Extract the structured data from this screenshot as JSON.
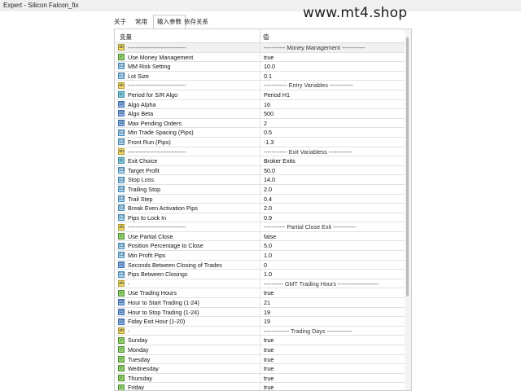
{
  "window": {
    "title": "Expert - Silicon Falcon_fix"
  },
  "watermark": "www.mt4.shop",
  "tabs": [
    {
      "label": "关于"
    },
    {
      "label": "常用"
    },
    {
      "label": "输入参数"
    },
    {
      "label": "依存关系"
    }
  ],
  "table": {
    "col_variable": "变量",
    "col_value": "值",
    "rows": [
      {
        "name": "------------------------------",
        "value": "----------- Money Management ------------",
        "icon": "variable-icon"
      },
      {
        "name": "Use Money Management",
        "value": "true",
        "icon": "boolean-icon"
      },
      {
        "name": "MM Risk Setting",
        "value": "10.0",
        "icon": "double-icon"
      },
      {
        "name": "Lot Size",
        "value": "0.1",
        "icon": "double-icon"
      },
      {
        "name": "------------------------------",
        "value": "------------ Entry Variables ------------",
        "icon": "variable-icon"
      },
      {
        "name": "Period for S/R Algo",
        "value": "Period H1",
        "icon": "enum-icon"
      },
      {
        "name": "Algo Alpha",
        "value": "16",
        "icon": "integer-icon"
      },
      {
        "name": "Algo Beta",
        "value": "500",
        "icon": "integer-icon"
      },
      {
        "name": "Max Pending Orders",
        "value": "2",
        "icon": "integer-icon"
      },
      {
        "name": "Min Trade Spacing (Pips)",
        "value": "0.5",
        "icon": "double-icon"
      },
      {
        "name": "Front Run (Pips)",
        "value": "-1.3",
        "icon": "double-icon"
      },
      {
        "name": "------------------------------",
        "value": "------------ Exit Variabless ------------",
        "icon": "variable-icon"
      },
      {
        "name": "Exit Choice",
        "value": "Broker Exits",
        "icon": "enum-icon"
      },
      {
        "name": "Target Profit",
        "value": "50.0",
        "icon": "double-icon"
      },
      {
        "name": "Stop Loss",
        "value": "14.0",
        "icon": "double-icon"
      },
      {
        "name": "Trailing Stop",
        "value": "2.0",
        "icon": "double-icon"
      },
      {
        "name": "Trail Step",
        "value": "0.4",
        "icon": "double-icon"
      },
      {
        "name": "Break Even Activation Pips",
        "value": "2.0",
        "icon": "double-icon"
      },
      {
        "name": "Pips to Lock In",
        "value": "0.9",
        "icon": "double-icon"
      },
      {
        "name": "------------------------------",
        "value": "----------- Partial Close Exit ------------",
        "icon": "variable-icon"
      },
      {
        "name": "Use Partial Close",
        "value": "false",
        "icon": "boolean-icon"
      },
      {
        "name": "Position Percentage to Close",
        "value": "5.0",
        "icon": "double-icon"
      },
      {
        "name": "Min Profit Pips",
        "value": "1.0",
        "icon": "double-icon"
      },
      {
        "name": "Seconds Between Closing of Trades",
        "value": "0",
        "icon": "integer-icon"
      },
      {
        "name": "Pips Between Closings",
        "value": "1.0",
        "icon": "double-icon"
      },
      {
        "name": "-",
        "value": "---------- GMT Trading Hours ---------------------",
        "icon": "variable-icon"
      },
      {
        "name": "Use Trading Hours",
        "value": "true",
        "icon": "boolean-icon"
      },
      {
        "name": "Hour to Start Trading (1-24)",
        "value": "21",
        "icon": "integer-icon"
      },
      {
        "name": "Hour to Stop Trading (1-24)",
        "value": "19",
        "icon": "integer-icon"
      },
      {
        "name": "Fiday Exit Hour (1-20)",
        "value": "19",
        "icon": "integer-icon"
      },
      {
        "name": "-",
        "value": "------------- Trading Days -------------",
        "icon": "variable-icon"
      },
      {
        "name": "Sunday",
        "value": "true",
        "icon": "boolean-icon"
      },
      {
        "name": "Monday",
        "value": "true",
        "icon": "boolean-icon"
      },
      {
        "name": "Tuesday",
        "value": "true",
        "icon": "boolean-icon"
      },
      {
        "name": "Wednesday",
        "value": "true",
        "icon": "boolean-icon"
      },
      {
        "name": "Thursday",
        "value": "true",
        "icon": "boolean-icon"
      },
      {
        "name": "Friday",
        "value": "true",
        "icon": "boolean-icon"
      }
    ]
  }
}
